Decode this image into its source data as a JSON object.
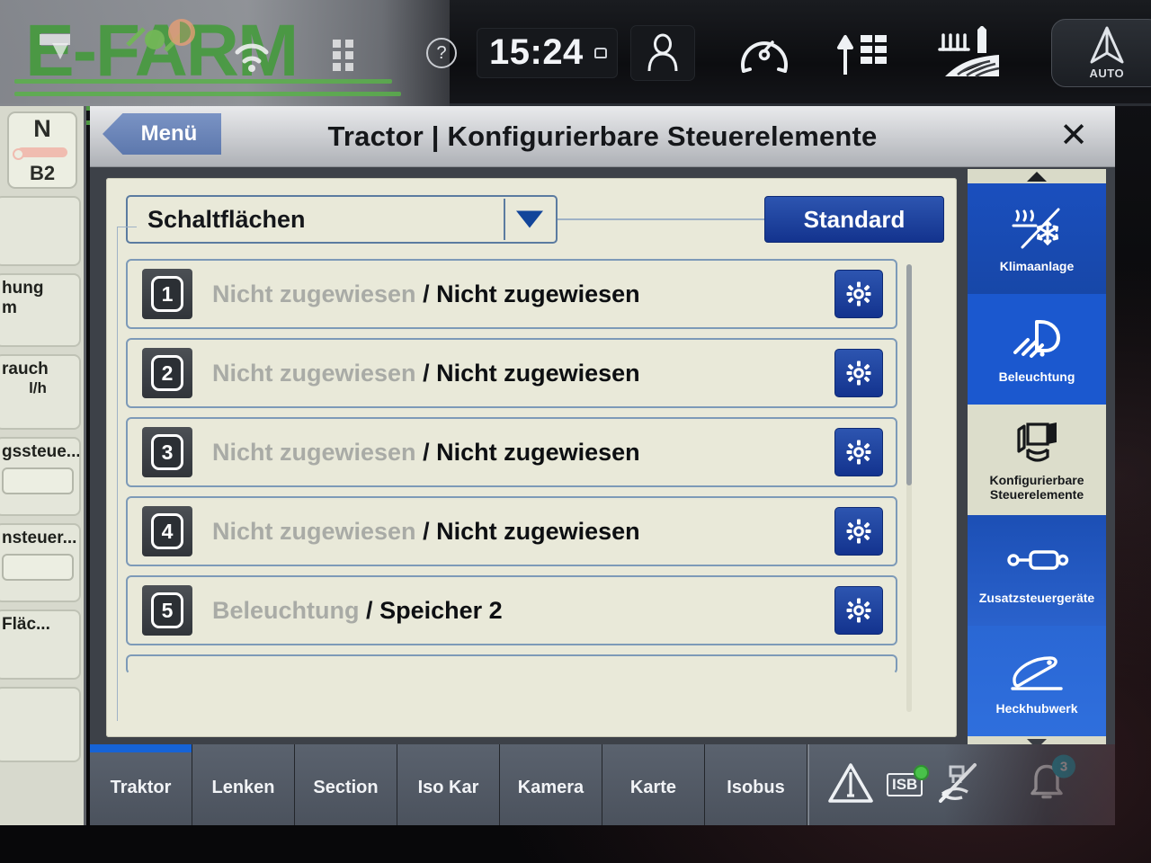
{
  "watermark": {
    "text": "E-FARM",
    "color": "#3f9c35"
  },
  "statusbar": {
    "help_icon": "help-circle-icon",
    "time": "15:24",
    "display_icon": "display-icon",
    "user_icon": "user-icon",
    "gauge_icon": "speedometer-icon",
    "shift_icon": "gear-shift-icon",
    "field_icon": "field-machine-icon",
    "auto_label": "AUTO",
    "auto_icon": "steering-auto-icon"
  },
  "left_strip": {
    "gear_top": "N",
    "gear_bottom": "B2",
    "cells": [
      {
        "title": "",
        "unit": ""
      },
      {
        "title": "hung",
        "unit": "m"
      },
      {
        "title": "rauch",
        "unit": "l/h"
      },
      {
        "title": "gssteue...",
        "unit": ""
      },
      {
        "title": "nsteuer...",
        "unit": ""
      },
      {
        "title": "Fläc...",
        "unit": ""
      },
      {
        "title": "",
        "unit": ""
      }
    ]
  },
  "titlebar": {
    "menu_label": "Menü",
    "back_icon": "chevron-left-icon",
    "title": "Tractor | Konfigurierbare Steuerelemente",
    "close_icon": "close-icon",
    "close_glyph": "✕"
  },
  "toolbar": {
    "dropdown_value": "Schaltflächen",
    "dropdown_icon": "chevron-down-icon",
    "standard_label": "Standard"
  },
  "list": {
    "gear_icon": "gear-icon",
    "rows": [
      {
        "number": "1",
        "assigned": "Nicht zugewiesen",
        "separator": "/",
        "value": "Nicht zugewiesen"
      },
      {
        "number": "2",
        "assigned": "Nicht zugewiesen",
        "separator": "/",
        "value": "Nicht zugewiesen"
      },
      {
        "number": "3",
        "assigned": "Nicht zugewiesen",
        "separator": "/",
        "value": "Nicht zugewiesen"
      },
      {
        "number": "4",
        "assigned": "Nicht zugewiesen",
        "separator": "/",
        "value": "Nicht zugewiesen"
      },
      {
        "number": "5",
        "assigned": "Beleuchtung",
        "separator": "/",
        "value": "Speicher 2"
      }
    ]
  },
  "sidebar": {
    "scroll_up_icon": "chevron-up-icon",
    "scroll_down_icon": "chevron-down-icon",
    "items": [
      {
        "label": "Klimaanlage",
        "icon": "climate-control-icon",
        "selected": false
      },
      {
        "label": "Beleuchtung",
        "icon": "headlight-icon",
        "selected": false
      },
      {
        "label": "Konfigurierbare Steuerelemente",
        "icon": "armrest-controls-icon",
        "selected": true
      },
      {
        "label": "Zusatzsteuergeräte",
        "icon": "hydraulic-cylinder-icon",
        "selected": false
      },
      {
        "label": "Heckhubwerk",
        "icon": "rear-linkage-icon",
        "selected": false
      }
    ]
  },
  "tabbar": {
    "tabs": [
      {
        "label": "Traktor",
        "active": true
      },
      {
        "label": "Lenken",
        "active": false
      },
      {
        "label": "Section",
        "active": false
      },
      {
        "label": "Iso Kar",
        "active": false
      },
      {
        "label": "Kamera",
        "active": false
      },
      {
        "label": "Karte",
        "active": false
      },
      {
        "label": "Isobus",
        "active": false
      }
    ],
    "status": {
      "warning_icon": "warning-triangle-icon",
      "isb_label": "ISB",
      "isb_status_icon": "green-status-dot",
      "implement_off_icon": "implement-disabled-icon",
      "bell_icon": "notification-bell-icon",
      "notification_count": "3"
    }
  },
  "colors": {
    "accent_blue": "#13338e",
    "sidebar_blue": "#1b58cf",
    "panel_bg": "#e9e9d9",
    "tab_active": "#1663d6",
    "badge_teal": "#2bb3c9",
    "brand_green": "#3f9c35"
  }
}
